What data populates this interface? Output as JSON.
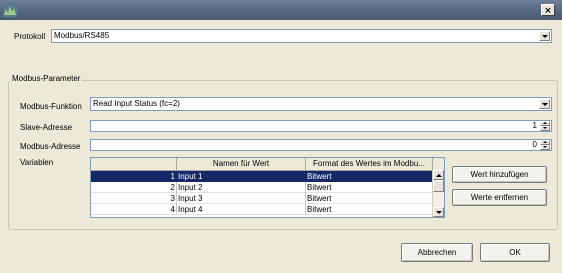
{
  "window": {
    "close_glyph": "×"
  },
  "protocol": {
    "label": "Protokoll",
    "value": "Modbus/RS485"
  },
  "group": {
    "title": "Modbus-Parameter"
  },
  "function": {
    "label": "Modbus-Funktion",
    "value": "Read Input Status (fc=2)"
  },
  "slave": {
    "label": "Slave-Adresse",
    "value": "1"
  },
  "address": {
    "label": "Modbus-Adresse",
    "value": "0"
  },
  "variables": {
    "label": "Variablen",
    "columns": [
      "",
      "Namen für Wert",
      "Format des Wertes im Modbu..."
    ],
    "rows": [
      {
        "num": "1",
        "name": "Input 1",
        "format": "Bitwert",
        "selected": true
      },
      {
        "num": "2",
        "name": "Input 2",
        "format": "Bitwert",
        "selected": false
      },
      {
        "num": "3",
        "name": "Input 3",
        "format": "Bitwert",
        "selected": false
      },
      {
        "num": "4",
        "name": "Input 4",
        "format": "Bitwert",
        "selected": false
      }
    ]
  },
  "buttons": {
    "add_value": "Wert hinzufügen",
    "remove_values": "Werte entfernen",
    "cancel": "Abbrechen",
    "ok": "OK"
  },
  "colors": {
    "selection": "#172869",
    "titlebar": "#56667f",
    "dialog_bg": "#ece9d8"
  },
  "icons": [
    "app-icon",
    "close-icon",
    "dropdown-arrow-icon",
    "spinner-up-icon",
    "spinner-down-icon",
    "scroll-up-icon",
    "scroll-down-icon"
  ]
}
